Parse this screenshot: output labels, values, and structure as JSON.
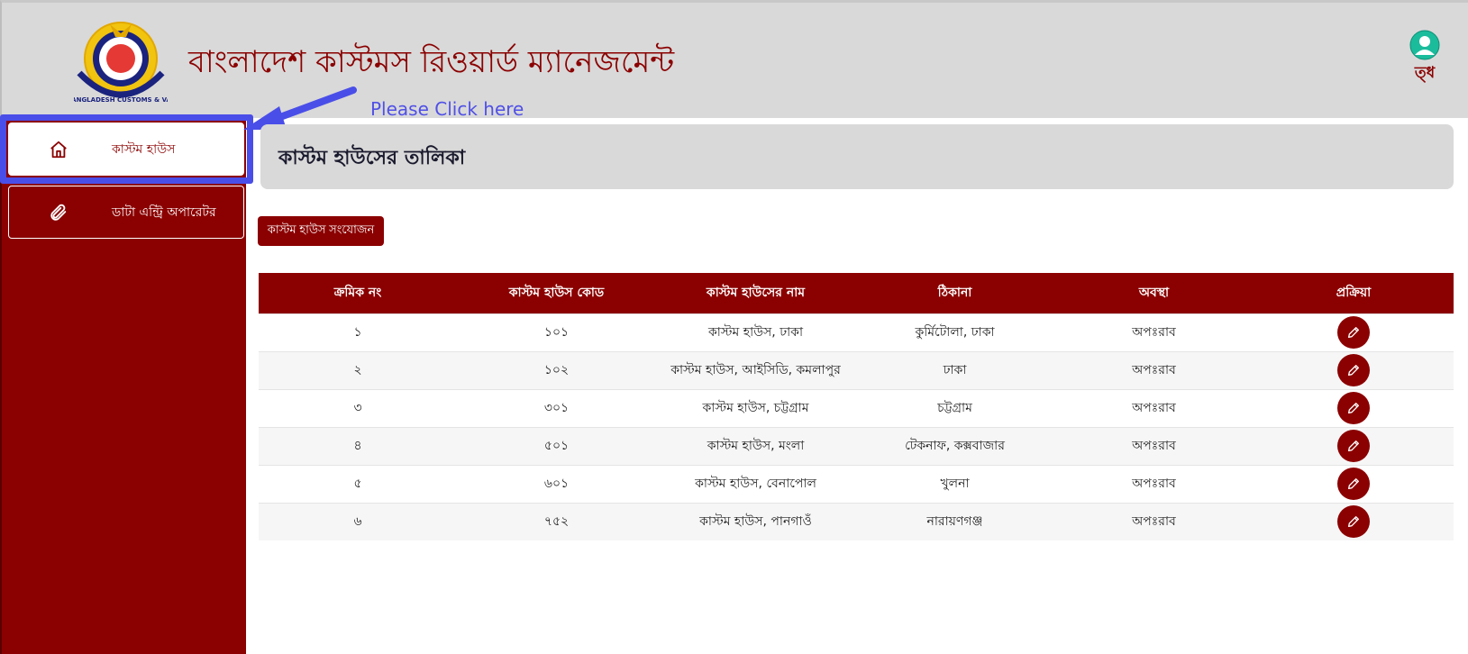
{
  "header": {
    "app_title": "বাংলাদেশ কাস্টমস রিওয়ার্ড ম্যানেজমেন্ট",
    "logo_text": "BANGLADESH CUSTOMS & VAT",
    "hint_text": "Please Click here",
    "user_name": "ত্ধ"
  },
  "sidebar": {
    "items": [
      {
        "label": "কাস্টম হাউস",
        "icon": "home-icon",
        "active": true
      },
      {
        "label": "ডাটা এন্ট্রি অপারেটর",
        "icon": "paperclip-icon",
        "active": false
      }
    ]
  },
  "main": {
    "page_title": "কাস্টম হাউসের তালিকা",
    "add_button_label": "কাস্টম হাউস সংযোজন",
    "table": {
      "columns": [
        "ক্রমিক নং",
        "কাস্টম হাউস কোড",
        "কাস্টম হাউসের নাম",
        "ঠিকানা",
        "অবস্থা",
        "প্রক্রিয়া"
      ],
      "rows": [
        [
          "১",
          "১০১",
          "কাস্টম হাউস, ঢাকা",
          "কুর্মিটোলা, ঢাকা",
          "অপঃরাব"
        ],
        [
          "২",
          "১০২",
          "কাস্টম হাউস, আইসিডি, কমলাপুর",
          "ঢাকা",
          "অপঃরাব"
        ],
        [
          "৩",
          "৩০১",
          "কাস্টম হাউস, চট্টগ্রাম",
          "চট্টগ্রাম",
          "অপঃরাব"
        ],
        [
          "৪",
          "৫০১",
          "কাস্টম হাউস, মংলা",
          "টেকনাফ, কক্সবাজার",
          "অপঃরাব"
        ],
        [
          "৫",
          "৬০১",
          "কাস্টম হাউস, বেনাপোল",
          "খুলনা",
          "অপঃরাব"
        ],
        [
          "৬",
          "৭৫২",
          "কাস্টম হাউস, পানগাওঁ",
          "নারায়ণগঞ্জ",
          "অপঃরাব"
        ]
      ]
    }
  },
  "colors": {
    "brand": "#8b0000",
    "header_bg": "#d9d9d9",
    "highlight": "#4a4ee8"
  }
}
